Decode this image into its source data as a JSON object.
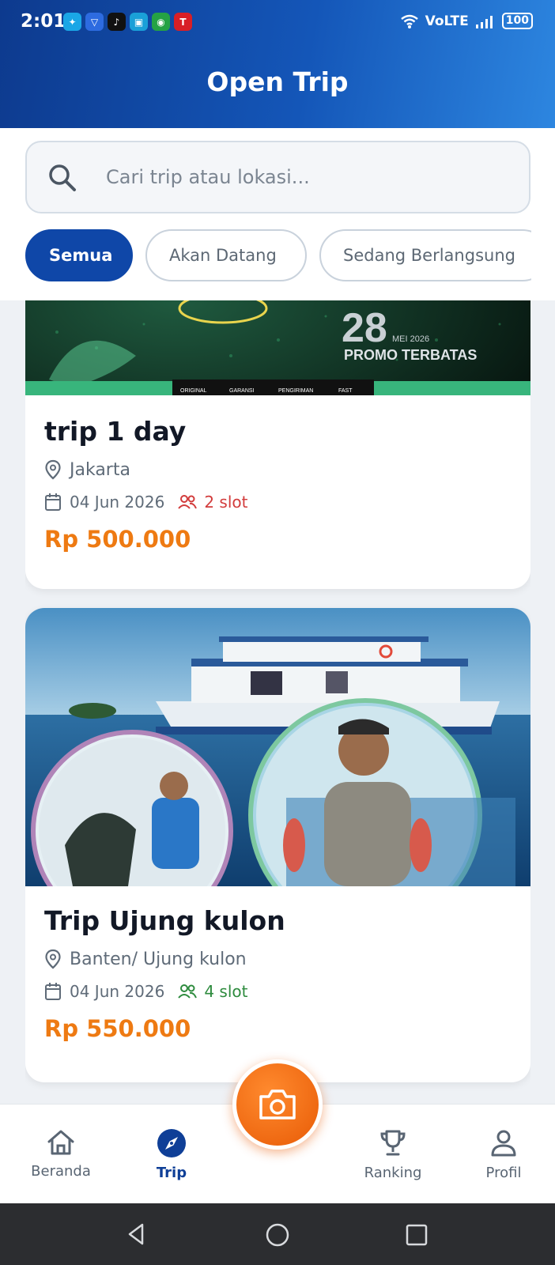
{
  "status_bar": {
    "time": "2:01",
    "network": "VoLTE",
    "battery": "100"
  },
  "header": {
    "title": "Open Trip"
  },
  "search": {
    "placeholder": "Cari trip atau lokasi...",
    "value": ""
  },
  "filters": [
    {
      "label": "Semua",
      "active": true
    },
    {
      "label": "Akan Datang",
      "active": false
    },
    {
      "label": "Sedang Berlangsung",
      "active": false
    }
  ],
  "banner": {
    "day": "28",
    "month": "MEI 2026",
    "promo": "PROMO TERBATAS",
    "features": [
      "ORIGINAL",
      "GARANSI",
      "PENGIRIMAN",
      "FAST"
    ]
  },
  "trips": [
    {
      "title": "trip 1 day",
      "location": "Jakarta",
      "date": "04 Jun 2026",
      "slots": "2 slot",
      "slot_color": "#d23c3c",
      "price": "Rp 500.000"
    },
    {
      "title": "Trip Ujung kulon",
      "location": "Banten/ Ujung kulon",
      "date": "04 Jun 2026",
      "slots": "4 slot",
      "slot_color": "#2e8b3e",
      "price": "Rp 550.000"
    }
  ],
  "bottom_nav": [
    {
      "label": "Beranda",
      "icon": "home-icon",
      "active": false
    },
    {
      "label": "Trip",
      "icon": "compass-icon",
      "active": true
    },
    {
      "label": "Ranking",
      "icon": "trophy-icon",
      "active": false
    },
    {
      "label": "Profil",
      "icon": "user-icon",
      "active": false
    }
  ],
  "fab": {
    "icon": "camera-icon"
  },
  "colors": {
    "primary": "#0f47a8",
    "accent": "#ee7a12"
  }
}
